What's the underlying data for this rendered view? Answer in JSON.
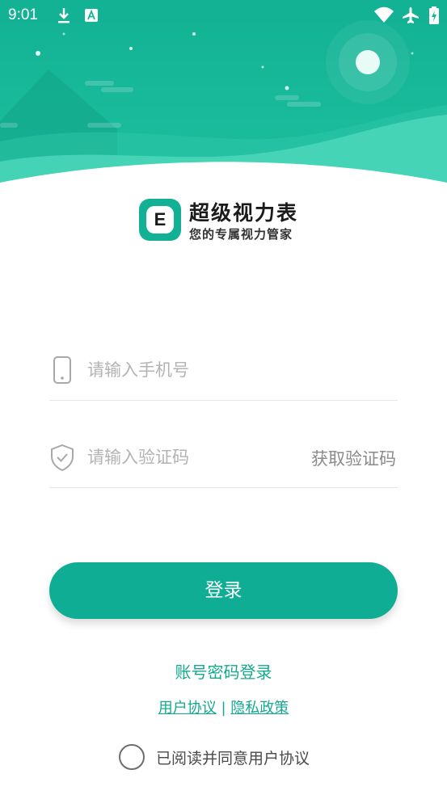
{
  "status_bar": {
    "time": "9:01",
    "icons": [
      "download-icon",
      "a-notification-icon",
      "wifi-icon",
      "airplane-mode-icon",
      "battery-icon"
    ]
  },
  "brand": {
    "logo_letter": "E",
    "title": "超级视力表",
    "slogan": "您的专属视力管家"
  },
  "form": {
    "phone_placeholder": "请输入手机号",
    "phone_value": "",
    "code_placeholder": "请输入验证码",
    "code_value": "",
    "get_code_label": "获取验证码",
    "phone_icon": "phone-icon",
    "code_icon": "shield-check-icon"
  },
  "actions": {
    "login_label": "登录",
    "password_login_label": "账号密码登录"
  },
  "legal": {
    "user_agreement": "用户协议",
    "separator": "|",
    "privacy_policy": "隐私政策"
  },
  "agreement": {
    "checked": false,
    "label": "已阅读并同意用户协议"
  },
  "colors": {
    "primary": "#0fae94",
    "header_bg": "#14b597",
    "link": "#14a98f"
  }
}
